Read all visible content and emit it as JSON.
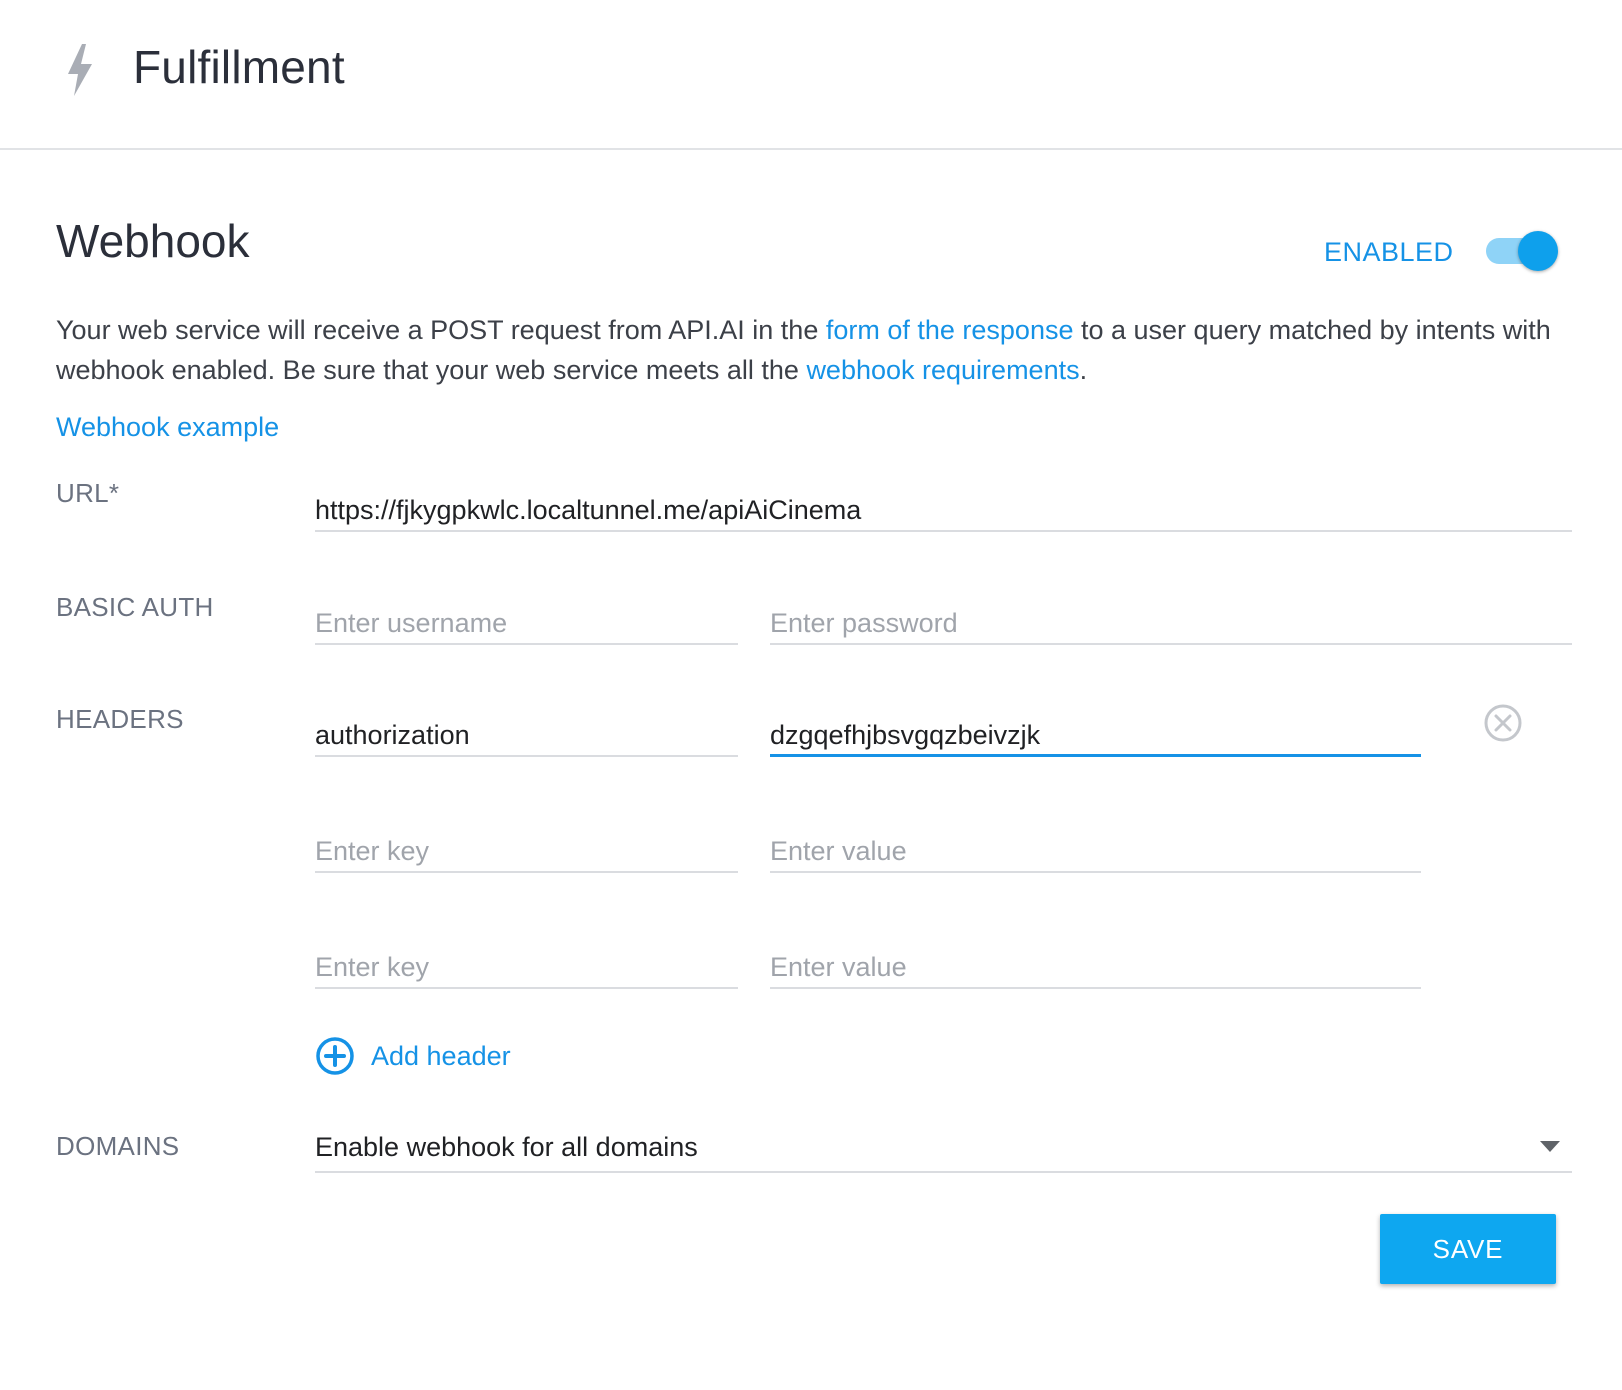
{
  "header": {
    "title": "Fulfillment",
    "icon": "lightning-bolt-icon"
  },
  "webhook": {
    "title": "Webhook",
    "status_label": "ENABLED",
    "enabled": true,
    "description": {
      "part1": "Your web service will receive a POST request from API.AI in the ",
      "link1": "form of the response",
      "part2": " to a user query matched by intents with webhook enabled. Be sure that your web service meets all the ",
      "link2": "webhook requirements",
      "part3": "."
    },
    "example_link": "Webhook example"
  },
  "form": {
    "url": {
      "label": "URL*",
      "value": "https://fjkygpkwlc.localtunnel.me/apiAiCinema"
    },
    "basic_auth": {
      "label": "BASIC AUTH",
      "username_placeholder": "Enter username",
      "password_placeholder": "Enter password"
    },
    "headers": {
      "label": "HEADERS",
      "rows": [
        {
          "key": "authorization",
          "value": "dzgqefhjbsvgqzbeivzjk"
        },
        {
          "key_placeholder": "Enter key",
          "value_placeholder": "Enter value"
        },
        {
          "key_placeholder": "Enter key",
          "value_placeholder": "Enter value"
        }
      ],
      "add_label": "Add header"
    },
    "domains": {
      "label": "DOMAINS",
      "selected": "Enable webhook for all domains"
    }
  },
  "actions": {
    "save_label": "SAVE"
  },
  "colors": {
    "accent": "#1592e6",
    "button": "#0ea7f0",
    "toggle_thumb": "#0ea0ec",
    "toggle_track": "#8fd3f7"
  }
}
